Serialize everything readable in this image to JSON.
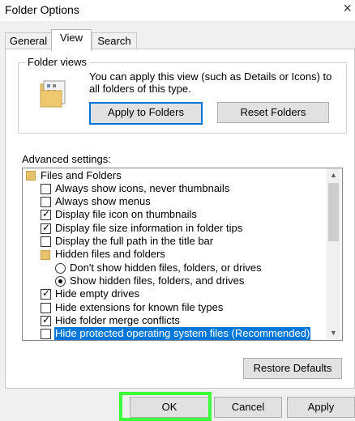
{
  "window": {
    "title": "Folder Options",
    "close_glyph": "×"
  },
  "tabs": [
    {
      "label": "General"
    },
    {
      "label": "View"
    },
    {
      "label": "Search"
    }
  ],
  "folder_views": {
    "legend": "Folder views",
    "description": "You can apply this view (such as Details or Icons) to all folders of this type.",
    "apply_label": "Apply to Folders",
    "reset_label": "Reset Folders"
  },
  "advanced": {
    "label": "Advanced settings:",
    "items": [
      {
        "type": "folder",
        "label": "Files and Folders"
      },
      {
        "type": "checkbox",
        "checked": false,
        "label": "Always show icons, never thumbnails"
      },
      {
        "type": "checkbox",
        "checked": false,
        "label": "Always show menus"
      },
      {
        "type": "checkbox",
        "checked": true,
        "label": "Display file icon on thumbnails"
      },
      {
        "type": "checkbox",
        "checked": true,
        "label": "Display file size information in folder tips"
      },
      {
        "type": "checkbox",
        "checked": false,
        "label": "Display the full path in the title bar"
      },
      {
        "type": "folder",
        "label": "Hidden files and folders"
      },
      {
        "type": "radio",
        "checked": false,
        "label": "Don't show hidden files, folders, or drives"
      },
      {
        "type": "radio",
        "checked": true,
        "label": "Show hidden files, folders, and drives"
      },
      {
        "type": "checkbox",
        "checked": true,
        "label": "Hide empty drives"
      },
      {
        "type": "checkbox",
        "checked": false,
        "label": "Hide extensions for known file types"
      },
      {
        "type": "checkbox",
        "checked": true,
        "label": "Hide folder merge conflicts"
      },
      {
        "type": "checkbox",
        "checked": false,
        "selected": true,
        "label": "Hide protected operating system files (Recommended)"
      }
    ],
    "restore_label": "Restore Defaults"
  },
  "footer": {
    "ok_label": "OK",
    "cancel_label": "Cancel",
    "apply_label": "Apply"
  },
  "colors": {
    "accent": "#0078d7",
    "highlight_box": "#3cff3c"
  },
  "icons": [
    "close-icon",
    "folder-views-icon",
    "folder-icon",
    "checkbox-icon",
    "radio-icon",
    "scroll-up-icon",
    "scroll-down-icon"
  ]
}
